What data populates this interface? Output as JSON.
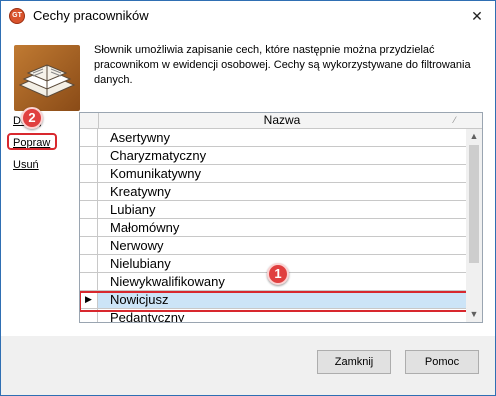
{
  "window": {
    "title": "Cechy pracowników",
    "app_icon": "gt-app-icon",
    "close_glyph": "✕"
  },
  "description": "Słownik umożliwia zapisanie cech, które następnie można przydzielać pracownikom w ewidencji osobowej. Cechy są wykorzystywane do filtrowania danych.",
  "sidebar": {
    "add_label": "Dodaj",
    "edit_label": "Popraw",
    "delete_label": "Usuń"
  },
  "grid": {
    "column_header": "Nazwa",
    "current_row_marker": "▶",
    "rows": [
      {
        "name": "Asertywny",
        "selected": false
      },
      {
        "name": "Charyzmatyczny",
        "selected": false
      },
      {
        "name": "Komunikatywny",
        "selected": false
      },
      {
        "name": "Kreatywny",
        "selected": false
      },
      {
        "name": "Lubiany",
        "selected": false
      },
      {
        "name": "Małomówny",
        "selected": false
      },
      {
        "name": "Nerwowy",
        "selected": false
      },
      {
        "name": "Nielubiany",
        "selected": false
      },
      {
        "name": "Niewykwalifikowany",
        "selected": false
      },
      {
        "name": "Nowicjusz",
        "selected": true
      },
      {
        "name": "Pedantyczny",
        "selected": false
      }
    ]
  },
  "annotations": {
    "badge_1": "1",
    "badge_2": "2",
    "highlight_color": "#d8282e"
  },
  "buttons": {
    "close_label": "Zamknij",
    "help_label": "Pomoc"
  },
  "colors": {
    "selection": "#cce4f7",
    "window_border": "#2f6fb3"
  }
}
